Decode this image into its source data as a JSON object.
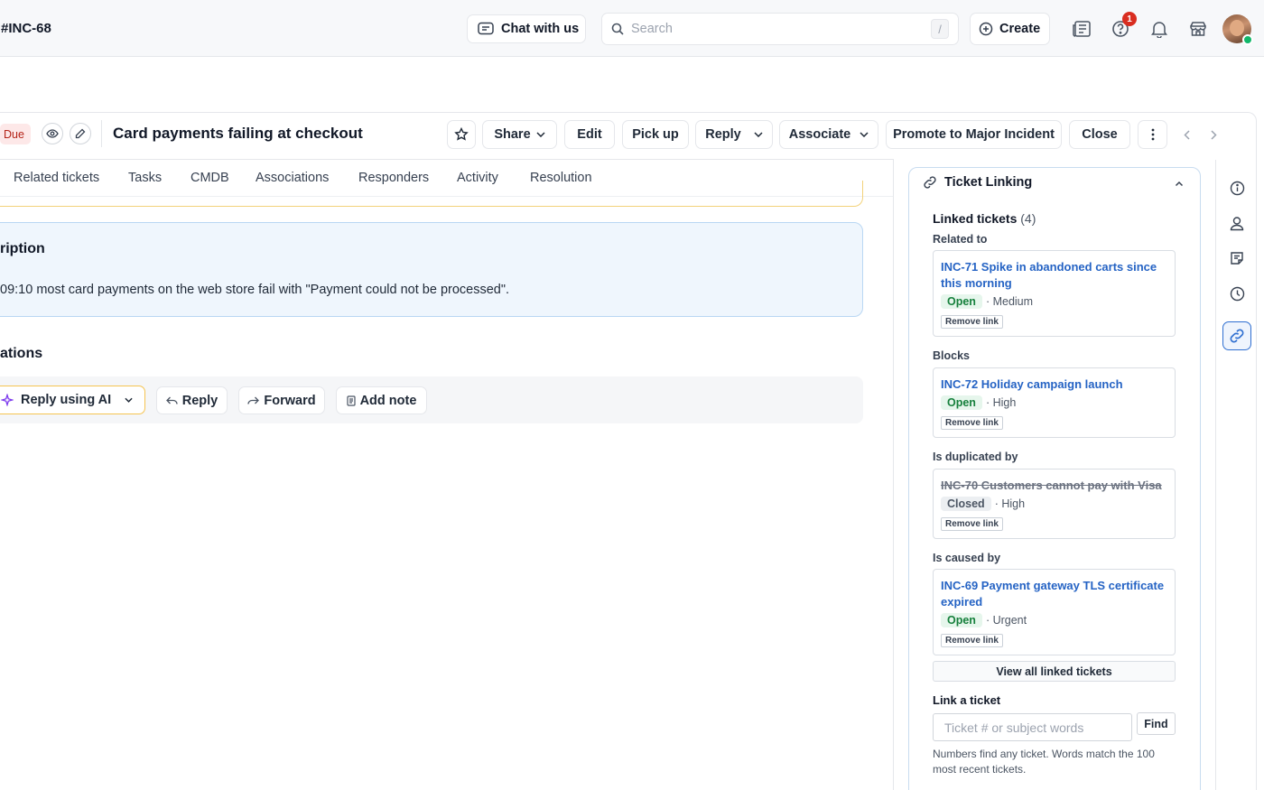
{
  "topbar": {
    "ticket_id": "#INC-68",
    "chat_label": "Chat with us",
    "search_placeholder": "Search",
    "search_shortcut": "/",
    "create_label": "Create",
    "notification_count": "1"
  },
  "header": {
    "due_badge": "Due",
    "title": "Card payments failing at checkout",
    "buttons": {
      "share": "Share",
      "edit": "Edit",
      "pick_up": "Pick up",
      "reply": "Reply",
      "associate": "Associate",
      "promote": "Promote to Major Incident",
      "close": "Close"
    }
  },
  "tabs": [
    "Related tickets",
    "Tasks",
    "CMDB",
    "Associations",
    "Responders",
    "Activity",
    "Resolution"
  ],
  "description": {
    "title": "ription",
    "text": "09:10 most card payments on the web store fail with \"Payment could not be processed\"."
  },
  "conversations": {
    "title": "ations",
    "actions": {
      "reply_ai": "Reply using AI",
      "reply": "Reply",
      "forward": "Forward",
      "add_note": "Add note"
    }
  },
  "ticket_linking": {
    "header": "Ticket Linking",
    "linked_heading": "Linked tickets",
    "linked_count": "(4)",
    "groups": [
      {
        "label": "Related to",
        "title": "INC-71 Spike in abandoned carts since this morning",
        "status": "Open",
        "priority": "· Medium",
        "remove": "Remove link"
      },
      {
        "label": "Blocks",
        "title": "INC-72 Holiday campaign launch",
        "status": "Open",
        "priority": "· High",
        "remove": "Remove link"
      },
      {
        "label": "Is duplicated by",
        "title": "INC-70 Customers cannot pay with Visa",
        "status": "Closed",
        "priority": "· High",
        "remove": "Remove link"
      },
      {
        "label": "Is caused by",
        "title": "INC-69 Payment gateway TLS certificate expired",
        "status": "Open",
        "priority": "· Urgent",
        "remove": "Remove link"
      }
    ],
    "view_all": "View all linked tickets",
    "link_label": "Link a ticket",
    "link_placeholder": "Ticket # or subject words",
    "find_label": "Find",
    "help_text": "Numbers find any ticket. Words match the 100 most recent tickets."
  },
  "colors": {
    "accent": "#2f6fd1",
    "link": "#2563c4",
    "open_status": "#16803c",
    "due": "#b42318",
    "ai_border": "#f5c451"
  }
}
